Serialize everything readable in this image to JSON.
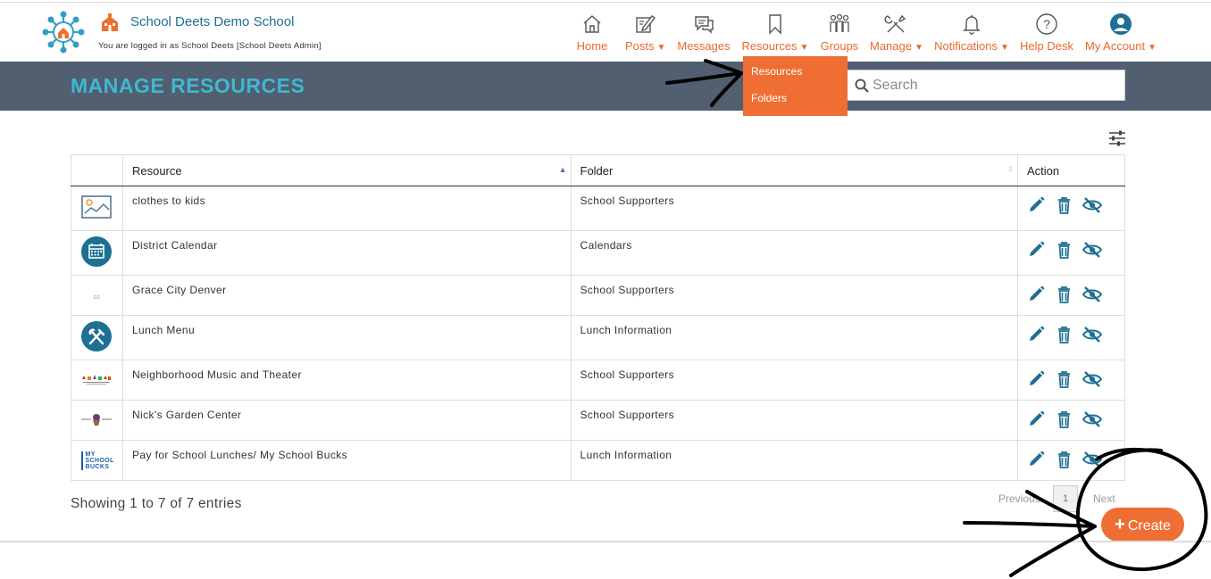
{
  "header": {
    "school_name": "School Deets Demo School",
    "logged_in_text": "You are logged in as School Deets [School Deets Admin]"
  },
  "nav": {
    "items": [
      {
        "label": "Home",
        "icon": "home-icon",
        "caret": ""
      },
      {
        "label": "Posts",
        "icon": "edit-icon",
        "caret": "▼"
      },
      {
        "label": "Messages",
        "icon": "chat-icon",
        "caret": ""
      },
      {
        "label": "Resources",
        "icon": "bookmark-icon",
        "caret": "▼"
      },
      {
        "label": "Groups",
        "icon": "people-icon",
        "caret": ""
      },
      {
        "label": "Manage",
        "icon": "tools-icon",
        "caret": "▼"
      },
      {
        "label": "Notifications",
        "icon": "bell-icon",
        "caret": "▼"
      },
      {
        "label": "Help Desk",
        "icon": "question-icon",
        "caret": ""
      },
      {
        "label": "My Account",
        "icon": "user-icon",
        "caret": "▼"
      }
    ]
  },
  "dropdown": {
    "items": [
      "Resources",
      "Folders"
    ]
  },
  "banner": {
    "title": "MANAGE RESOURCES"
  },
  "search": {
    "placeholder": "Search",
    "value": ""
  },
  "table": {
    "columns": [
      "Resource",
      "Folder",
      "Action"
    ],
    "rows": [
      {
        "thumb": "image-placeholder-icon",
        "resource": "clothes to kids",
        "folder": "School Supporters"
      },
      {
        "thumb": "calendar-icon",
        "resource": "District Calendar",
        "folder": "Calendars"
      },
      {
        "thumb": "cc-logo",
        "thumb_text": "cc",
        "resource": "Grace City Denver",
        "folder": "School Supporters"
      },
      {
        "thumb": "fork-knife-icon",
        "resource": "Lunch Menu",
        "folder": "Lunch Information"
      },
      {
        "thumb": "music-theater-logo",
        "resource": "Neighborhood Music and Theater",
        "folder": "School Supporters"
      },
      {
        "thumb": "garden-center-logo",
        "resource": "Nick's Garden Center",
        "folder": "School Supporters"
      },
      {
        "thumb": "myschoolbucks-logo",
        "thumb_text": "MY SCHOOL BUCKS",
        "resource": "Pay for School Lunches/ My School Bucks",
        "folder": "Lunch Information"
      }
    ],
    "actions": [
      "edit-icon",
      "trash-icon",
      "eye-slash-icon"
    ]
  },
  "footer": {
    "showing": "Showing 1 to 7 of 7 entries",
    "previous": "Previous",
    "page": "1",
    "next": "Next",
    "create": "Create"
  },
  "colors": {
    "accent": "#ef6e33",
    "banner": "#515f70",
    "title": "#3fb8d2",
    "icon_blue": "#1d6f93"
  }
}
